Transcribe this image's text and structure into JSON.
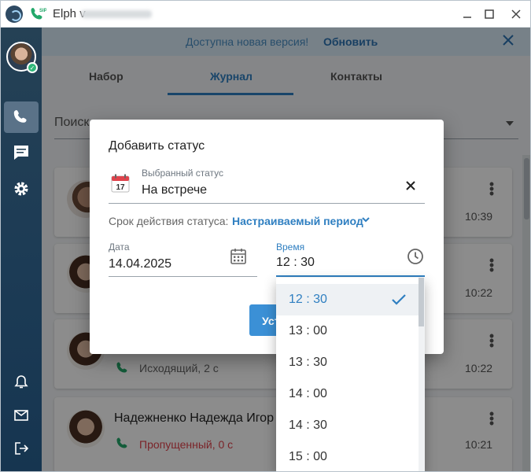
{
  "titlebar": {
    "title": "Elph v",
    "icons": {
      "logo": "app-logo-icon",
      "sip": "sip-phone-icon",
      "minimize": "minimize-icon",
      "maximize": "maximize-icon",
      "close": "close-icon"
    }
  },
  "sidebar": {
    "items": [
      {
        "name": "calls",
        "icon": "phone-icon",
        "active": true
      },
      {
        "name": "messages",
        "icon": "chat-icon",
        "active": false
      },
      {
        "name": "settings",
        "icon": "gear-icon",
        "active": false
      },
      {
        "name": "notifications",
        "icon": "bell-icon",
        "active": false
      },
      {
        "name": "mail",
        "icon": "mail-icon",
        "active": false
      },
      {
        "name": "logout",
        "icon": "logout-icon",
        "active": false
      }
    ]
  },
  "banner": {
    "text": "Доступна новая версия!",
    "link": "Обновить"
  },
  "tabs": [
    {
      "label": "Набор"
    },
    {
      "label": "Журнал"
    },
    {
      "label": "Контакты"
    }
  ],
  "search": {
    "placeholder": "Поиск"
  },
  "journal": {
    "cards": [
      {
        "time": "10:39"
      },
      {
        "time": "10:22"
      },
      {
        "status": "Исходящий, 2 с",
        "time": "10:22"
      },
      {
        "name": "Надежненко Надежда Игор",
        "status": "Пропущенный, 0 с",
        "time": "10:21"
      }
    ]
  },
  "dialog": {
    "title": "Добавить статус",
    "selected_status_label": "Выбранный статус",
    "selected_status_value": "На встрече",
    "validity_label": "Срок действия статуса:",
    "validity_value": "Настраиваемый период",
    "date_label": "Дата",
    "date_value": "14.04.2025",
    "time_label": "Время",
    "time_value": "12 : 30",
    "apply_button": "Установить"
  },
  "time_options": [
    "12 : 30",
    "13 : 00",
    "13 : 30",
    "14 : 00",
    "14 : 30",
    "15 : 00"
  ],
  "colors": {
    "accent": "#2f7fc1",
    "sidebar": "#1c3b55",
    "banner_bg": "#d9ebf7",
    "missed": "#e0434c",
    "online": "#2fb87a"
  }
}
